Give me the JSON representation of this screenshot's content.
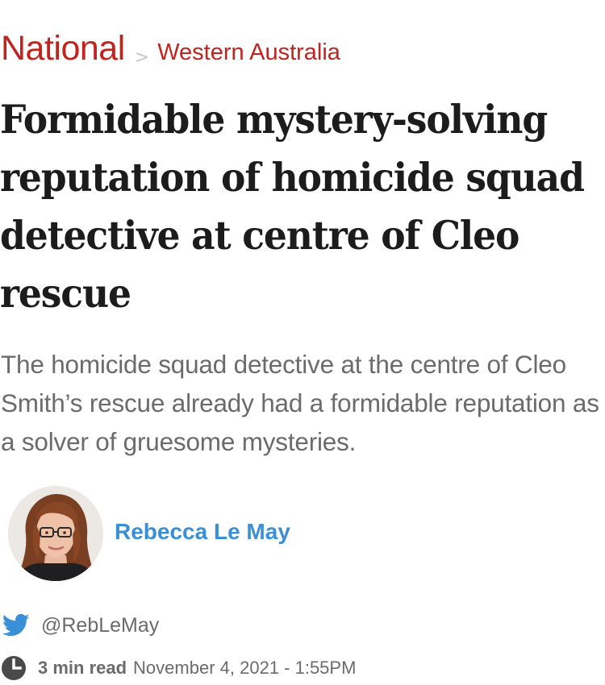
{
  "breadcrumb": {
    "section": "National",
    "separator": ">",
    "subsection": "Western Australia"
  },
  "article": {
    "headline": "Formidable mystery-solving reputation of homicide squad detective at centre of Cleo rescue",
    "standfirst": "The homicide squad detective at the centre of Cleo Smith’s rescue already had a formidable reputation as a solver of gruesome mysteries."
  },
  "author": {
    "name": "Rebecca Le May",
    "avatar_alt": "Rebecca Le May",
    "twitter_handle": "@RebLeMay"
  },
  "meta": {
    "read_time": "3 min read",
    "published": "November 4, 2021 - 1:55PM"
  },
  "colors": {
    "section": "#c0241f",
    "author": "#3a8fd6",
    "twitter": "#3a8fd6",
    "body_text": "#6b6b6b",
    "headline": "#1c1c1c"
  },
  "icons": {
    "twitter": "twitter-bird-icon",
    "clock": "clock-icon"
  }
}
